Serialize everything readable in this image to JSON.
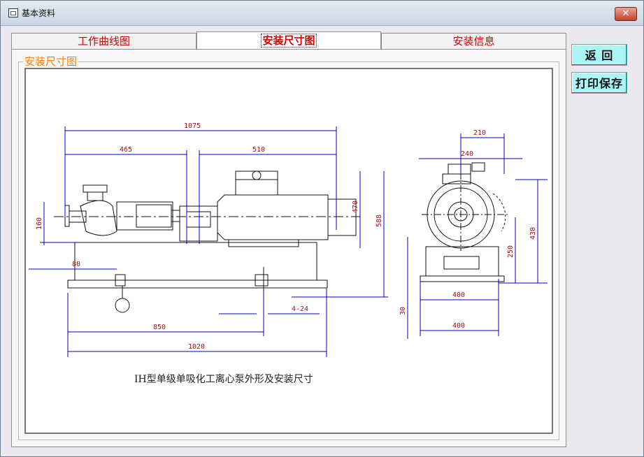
{
  "window": {
    "title": "基本资料",
    "close_label": "✕"
  },
  "tabs": [
    {
      "label": "工作曲线图"
    },
    {
      "label": "安装尺寸图"
    },
    {
      "label": "安装信息"
    }
  ],
  "group": {
    "label": "安装尺寸图"
  },
  "drawing": {
    "caption": "IH型单级单吸化工离心泵外形及安装尺寸",
    "dimensions": {
      "d1075": "1075",
      "d465": "465",
      "d510": "510",
      "d160": "160",
      "d80": "80",
      "d470": "470",
      "d588": "588",
      "d850": "850",
      "d1020": "1020",
      "d424": "4-24",
      "d210": "210",
      "d240": "240",
      "d430": "430",
      "d250": "250",
      "d400a": "400",
      "d400b": "400",
      "d30": "30"
    }
  },
  "buttons": {
    "back": "返 回",
    "print_save": "打印保存"
  }
}
